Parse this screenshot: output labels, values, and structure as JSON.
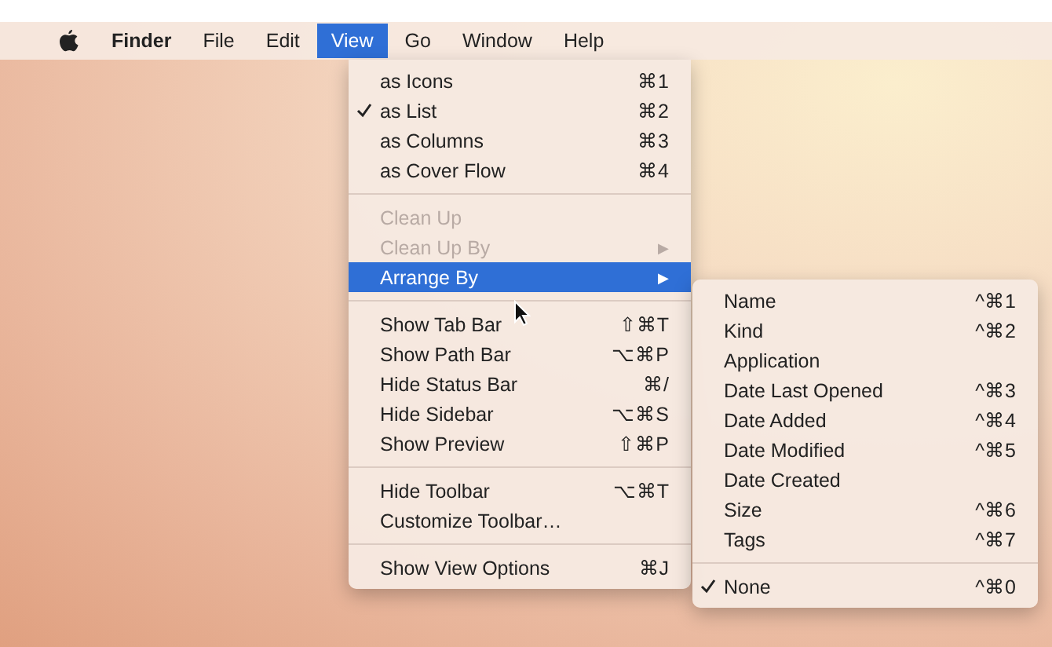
{
  "menubar": {
    "items": [
      {
        "label": "Finder",
        "selected": false,
        "bold": true
      },
      {
        "label": "File",
        "selected": false,
        "bold": false
      },
      {
        "label": "Edit",
        "selected": false,
        "bold": false
      },
      {
        "label": "View",
        "selected": true,
        "bold": false
      },
      {
        "label": "Go",
        "selected": false,
        "bold": false
      },
      {
        "label": "Window",
        "selected": false,
        "bold": false
      },
      {
        "label": "Help",
        "selected": false,
        "bold": false
      }
    ]
  },
  "view_menu": {
    "items": [
      {
        "kind": "item",
        "label": "as Icons",
        "shortcut": "⌘1",
        "checked": false,
        "disabled": false,
        "selected": false
      },
      {
        "kind": "item",
        "label": "as List",
        "shortcut": "⌘2",
        "checked": true,
        "disabled": false,
        "selected": false
      },
      {
        "kind": "item",
        "label": "as Columns",
        "shortcut": "⌘3",
        "checked": false,
        "disabled": false,
        "selected": false
      },
      {
        "kind": "item",
        "label": "as Cover Flow",
        "shortcut": "⌘4",
        "checked": false,
        "disabled": false,
        "selected": false
      },
      {
        "kind": "separator"
      },
      {
        "kind": "item",
        "label": "Clean Up",
        "checked": false,
        "disabled": true,
        "selected": false
      },
      {
        "kind": "item",
        "label": "Clean Up By",
        "submenu_arrow": "▶",
        "checked": false,
        "disabled": true,
        "selected": false
      },
      {
        "kind": "item",
        "label": "Arrange By",
        "submenu_arrow": "▶",
        "checked": false,
        "disabled": false,
        "selected": true
      },
      {
        "kind": "separator"
      },
      {
        "kind": "item",
        "label": "Show Tab Bar",
        "shortcut": "⇧⌘T",
        "checked": false,
        "disabled": false,
        "selected": false
      },
      {
        "kind": "item",
        "label": "Show Path Bar",
        "shortcut": "⌥⌘P",
        "checked": false,
        "disabled": false,
        "selected": false
      },
      {
        "kind": "item",
        "label": "Hide Status Bar",
        "shortcut": "⌘/",
        "checked": false,
        "disabled": false,
        "selected": false
      },
      {
        "kind": "item",
        "label": "Hide Sidebar",
        "shortcut": "⌥⌘S",
        "checked": false,
        "disabled": false,
        "selected": false
      },
      {
        "kind": "item",
        "label": "Show Preview",
        "shortcut": "⇧⌘P",
        "checked": false,
        "disabled": false,
        "selected": false
      },
      {
        "kind": "separator"
      },
      {
        "kind": "item",
        "label": "Hide Toolbar",
        "shortcut": "⌥⌘T",
        "checked": false,
        "disabled": false,
        "selected": false
      },
      {
        "kind": "item",
        "label": "Customize Toolbar…",
        "checked": false,
        "disabled": false,
        "selected": false
      },
      {
        "kind": "separator"
      },
      {
        "kind": "item",
        "label": "Show View Options",
        "shortcut": "⌘J",
        "checked": false,
        "disabled": false,
        "selected": false
      }
    ]
  },
  "arrange_by_menu": {
    "items": [
      {
        "kind": "item",
        "label": "Name",
        "shortcut": "^⌘1",
        "checked": false
      },
      {
        "kind": "item",
        "label": "Kind",
        "shortcut": "^⌘2",
        "checked": false
      },
      {
        "kind": "item",
        "label": "Application",
        "checked": false
      },
      {
        "kind": "item",
        "label": "Date Last Opened",
        "shortcut": "^⌘3",
        "checked": false
      },
      {
        "kind": "item",
        "label": "Date Added",
        "shortcut": "^⌘4",
        "checked": false
      },
      {
        "kind": "item",
        "label": "Date Modified",
        "shortcut": "^⌘5",
        "checked": false
      },
      {
        "kind": "item",
        "label": "Date Created",
        "checked": false
      },
      {
        "kind": "item",
        "label": "Size",
        "shortcut": "^⌘6",
        "checked": false
      },
      {
        "kind": "item",
        "label": "Tags",
        "shortcut": "^⌘7",
        "checked": false
      },
      {
        "kind": "separator"
      },
      {
        "kind": "item",
        "label": "None",
        "shortcut": "^⌘0",
        "checked": true
      }
    ]
  }
}
